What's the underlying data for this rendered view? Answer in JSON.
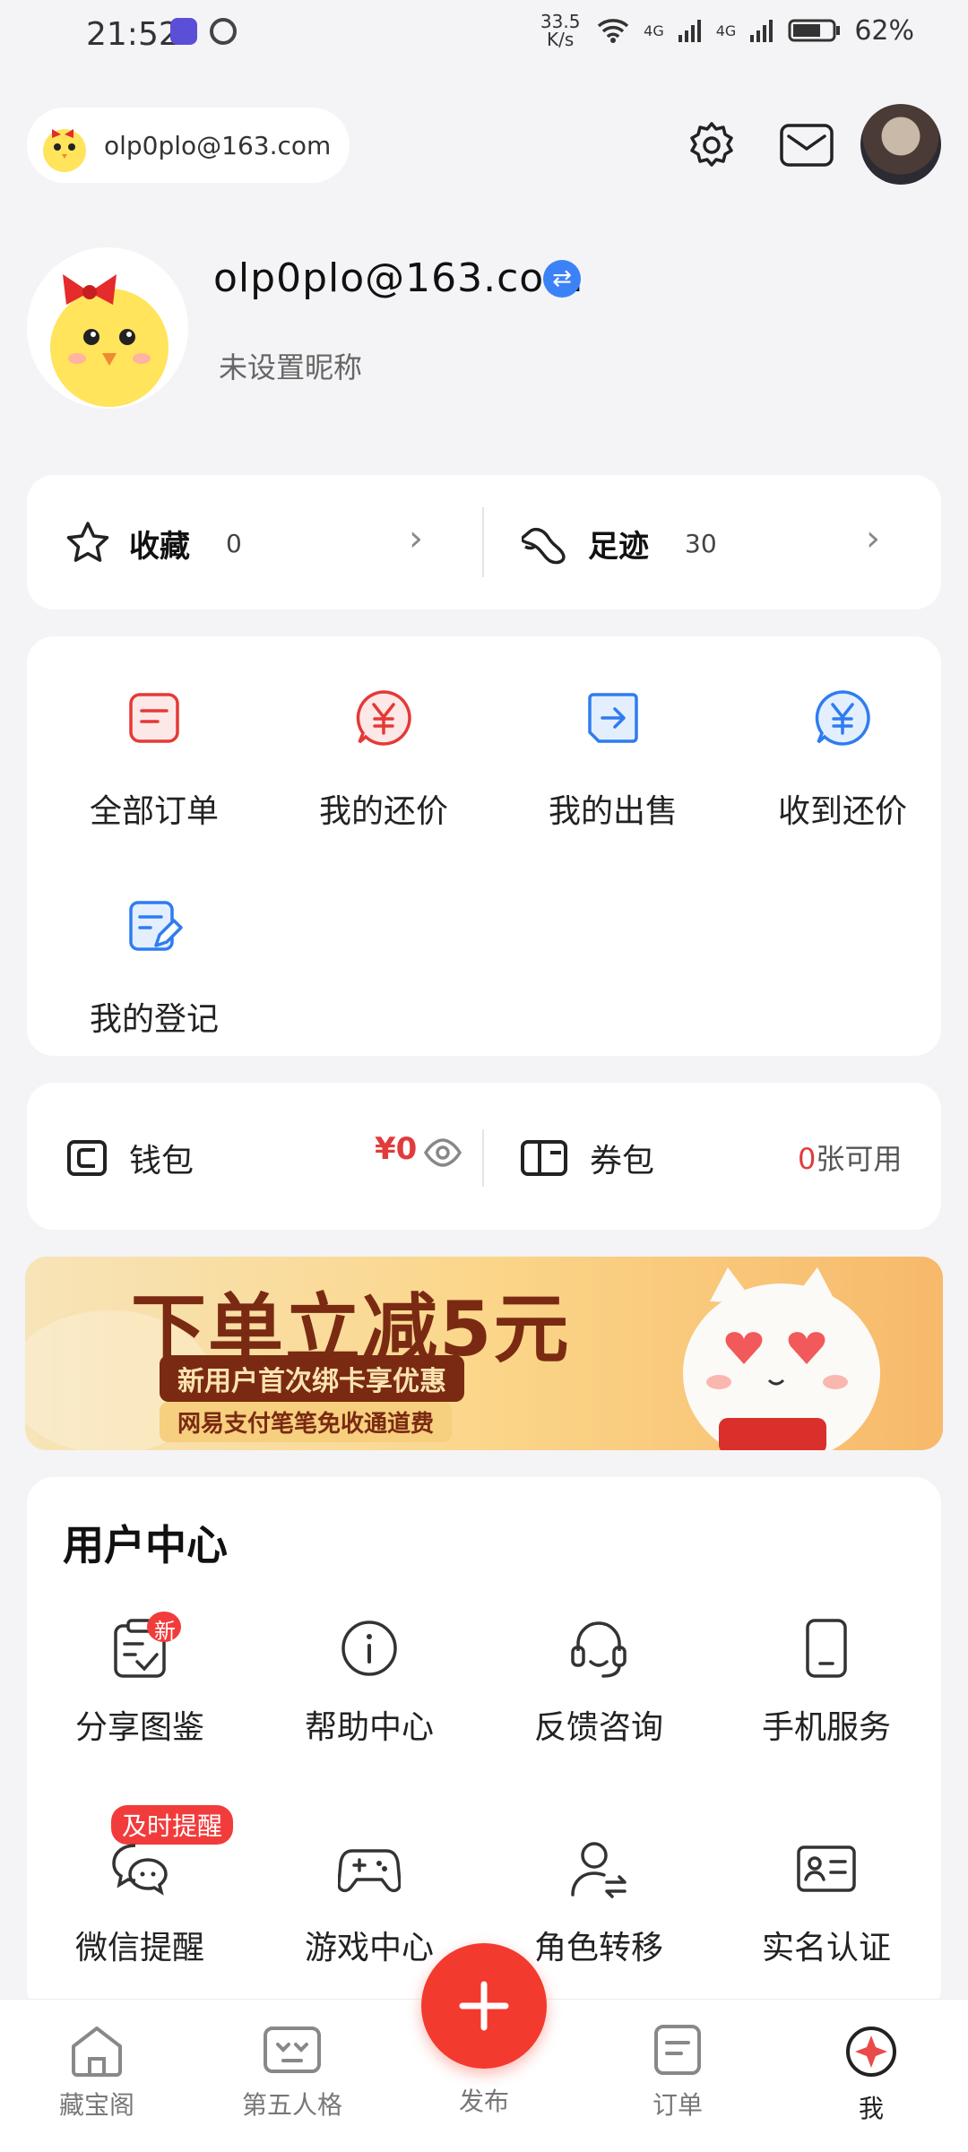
{
  "status_bar": {
    "time": "21:52",
    "speed": "33.5 K/s",
    "net1": "4G",
    "net2": "4G",
    "battery": "62%"
  },
  "header": {
    "account": "olp0plo@163.com"
  },
  "profile": {
    "name": "olp0plo@163.com",
    "nickname": "未设置昵称"
  },
  "quick": {
    "favorites": {
      "label": "收藏",
      "count": "0"
    },
    "footprints": {
      "label": "足迹",
      "count": "30"
    }
  },
  "orders": {
    "items": [
      {
        "label": "全部订单",
        "icon": "order-icon"
      },
      {
        "label": "我的还价",
        "icon": "yuan-icon"
      },
      {
        "label": "我的出售",
        "icon": "sell-icon"
      },
      {
        "label": "收到还价",
        "icon": "yuan-receive-icon"
      },
      {
        "label": "我的登记",
        "icon": "register-icon"
      }
    ]
  },
  "wallet": {
    "label": "钱包",
    "amount": "¥0",
    "coupon_label": "券包",
    "coupon_count": "0",
    "coupon_suffix": "张可用"
  },
  "banner": {
    "title": "下单立减5元",
    "sub1": "新用户首次绑卡享优惠",
    "sub2": "网易支付笔笔免收通道费"
  },
  "user_center": {
    "title": "用户中心",
    "items": [
      {
        "label": "分享图鉴",
        "badge": "新"
      },
      {
        "label": "帮助中心"
      },
      {
        "label": "反馈咨询"
      },
      {
        "label": "手机服务"
      },
      {
        "label": "微信提醒",
        "badge": "及时提醒"
      },
      {
        "label": "游戏中心"
      },
      {
        "label": "角色转移"
      },
      {
        "label": "实名认证"
      }
    ]
  },
  "bottom_nav": {
    "items": [
      {
        "label": "藏宝阁"
      },
      {
        "label": "第五人格"
      },
      {
        "label": "发布"
      },
      {
        "label": "订单"
      },
      {
        "label": "我"
      }
    ]
  },
  "colors": {
    "accent_red": "#f23a2f",
    "accent_blue": "#2f7cf0",
    "price_red": "#e23b3b"
  }
}
